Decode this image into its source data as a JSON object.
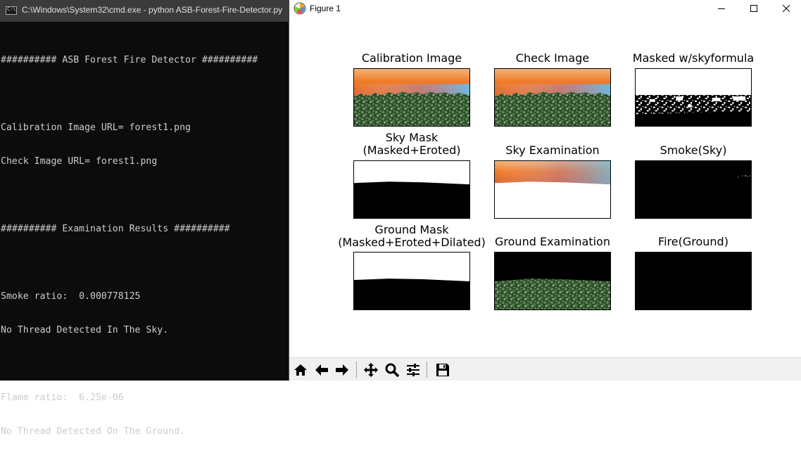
{
  "cmd": {
    "title": "C:\\Windows\\System32\\cmd.exe - python  ASB-Forest-Fire-Detector.py",
    "lines": [
      "########## ASB Forest Fire Detector ##########",
      "",
      "Calibration Image URL= forest1.png",
      "Check Image URL= forest1.png",
      "",
      "########## Examination Results ##########",
      "",
      "Smoke ratio:  0.000778125",
      "No Thread Detected In The Sky.",
      "",
      "Flame ratio:  6.25e-06",
      "No Thread Detected On The Ground."
    ]
  },
  "figure": {
    "title": "Figure 1",
    "panels": [
      {
        "title": "Calibration Image",
        "kind": "forest"
      },
      {
        "title": "Check Image",
        "kind": "forest"
      },
      {
        "title": "Masked w/skyformula",
        "kind": "masked"
      },
      {
        "title": "Sky Mask\n(Masked+Eroted)",
        "kind": "skymask"
      },
      {
        "title": "Sky Examination",
        "kind": "skyexam"
      },
      {
        "title": "Smoke(Sky)",
        "kind": "smoke"
      },
      {
        "title": "Ground Mask\n(Masked+Eroted+Dilated)",
        "kind": "groundmask"
      },
      {
        "title": "Ground Examination",
        "kind": "groundexam"
      },
      {
        "title": "Fire(Ground)",
        "kind": "fire"
      }
    ],
    "toolbar": [
      "home-icon",
      "back-arrow-icon",
      "forward-arrow-icon",
      "pan-icon",
      "zoom-icon",
      "configure-subplots-icon",
      "save-icon"
    ]
  },
  "colors": {
    "cmd_bg": "#0c0c0c",
    "cmd_text": "#cccccc",
    "sky_orange": "#f07a28",
    "sky_blue": "#6fb7e8",
    "forest_green": "#3f6a3a"
  }
}
